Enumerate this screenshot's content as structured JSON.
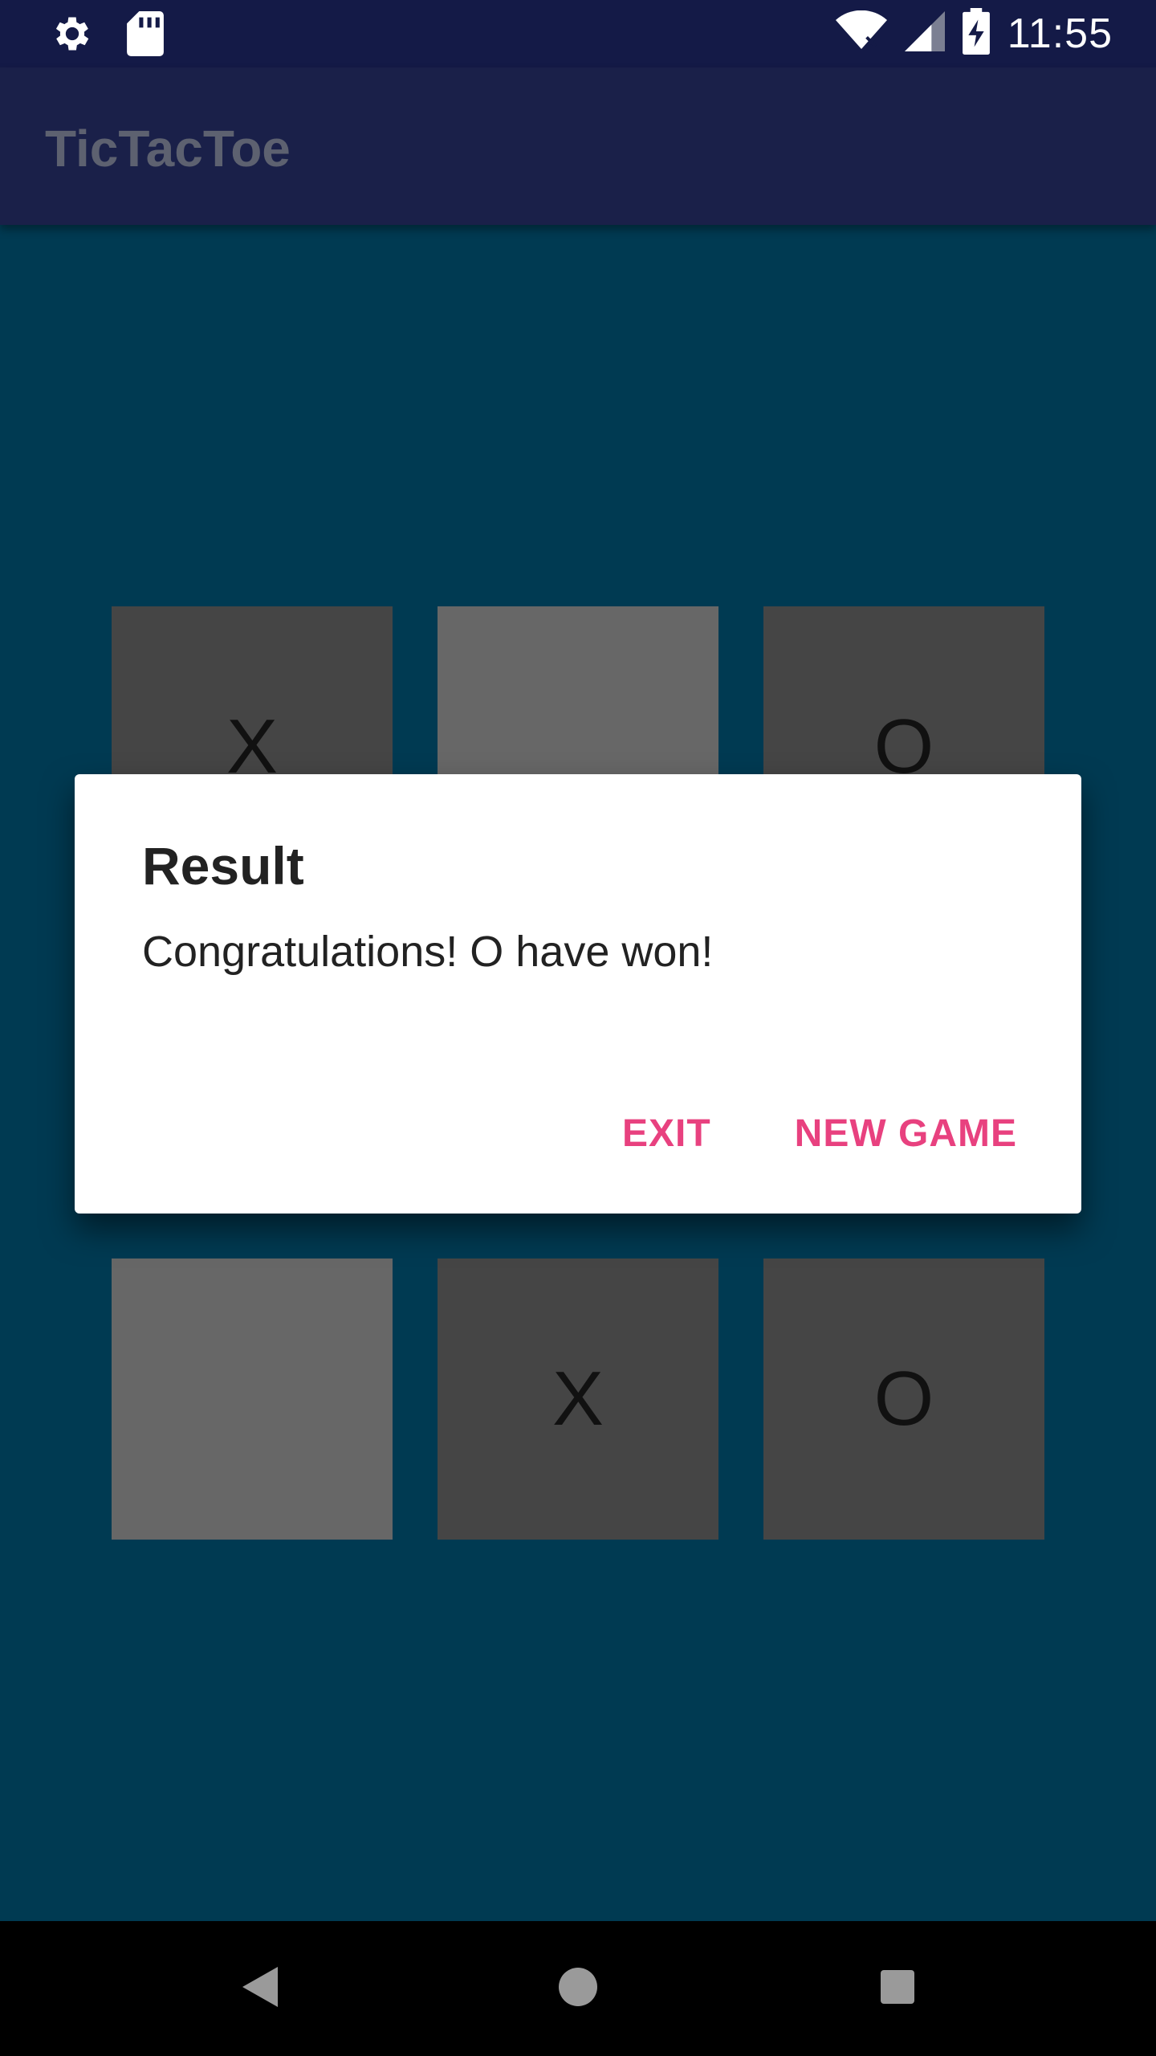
{
  "status_bar": {
    "time": "11:55",
    "icons": [
      "settings-icon",
      "sd-card-icon",
      "wifi-icon",
      "signal-icon",
      "battery-charging-icon"
    ]
  },
  "app_bar": {
    "title": "TicTacToe"
  },
  "board": {
    "cells": [
      "X",
      "",
      "O",
      "",
      "",
      "",
      "",
      "X",
      "O"
    ]
  },
  "dialog": {
    "title": "Result",
    "message": "Congratulations! O have won!",
    "exit_label": "EXIT",
    "new_game_label": "NEW GAME",
    "accent_color": "#e8417f"
  },
  "nav_bar": {
    "icons": [
      "back-icon",
      "home-icon",
      "recents-icon"
    ]
  },
  "colors": {
    "background": "#003a52",
    "status_bar": "#141a47",
    "app_bar": "#1a2049",
    "filled_cell": "#454545",
    "empty_cell": "#676767"
  }
}
